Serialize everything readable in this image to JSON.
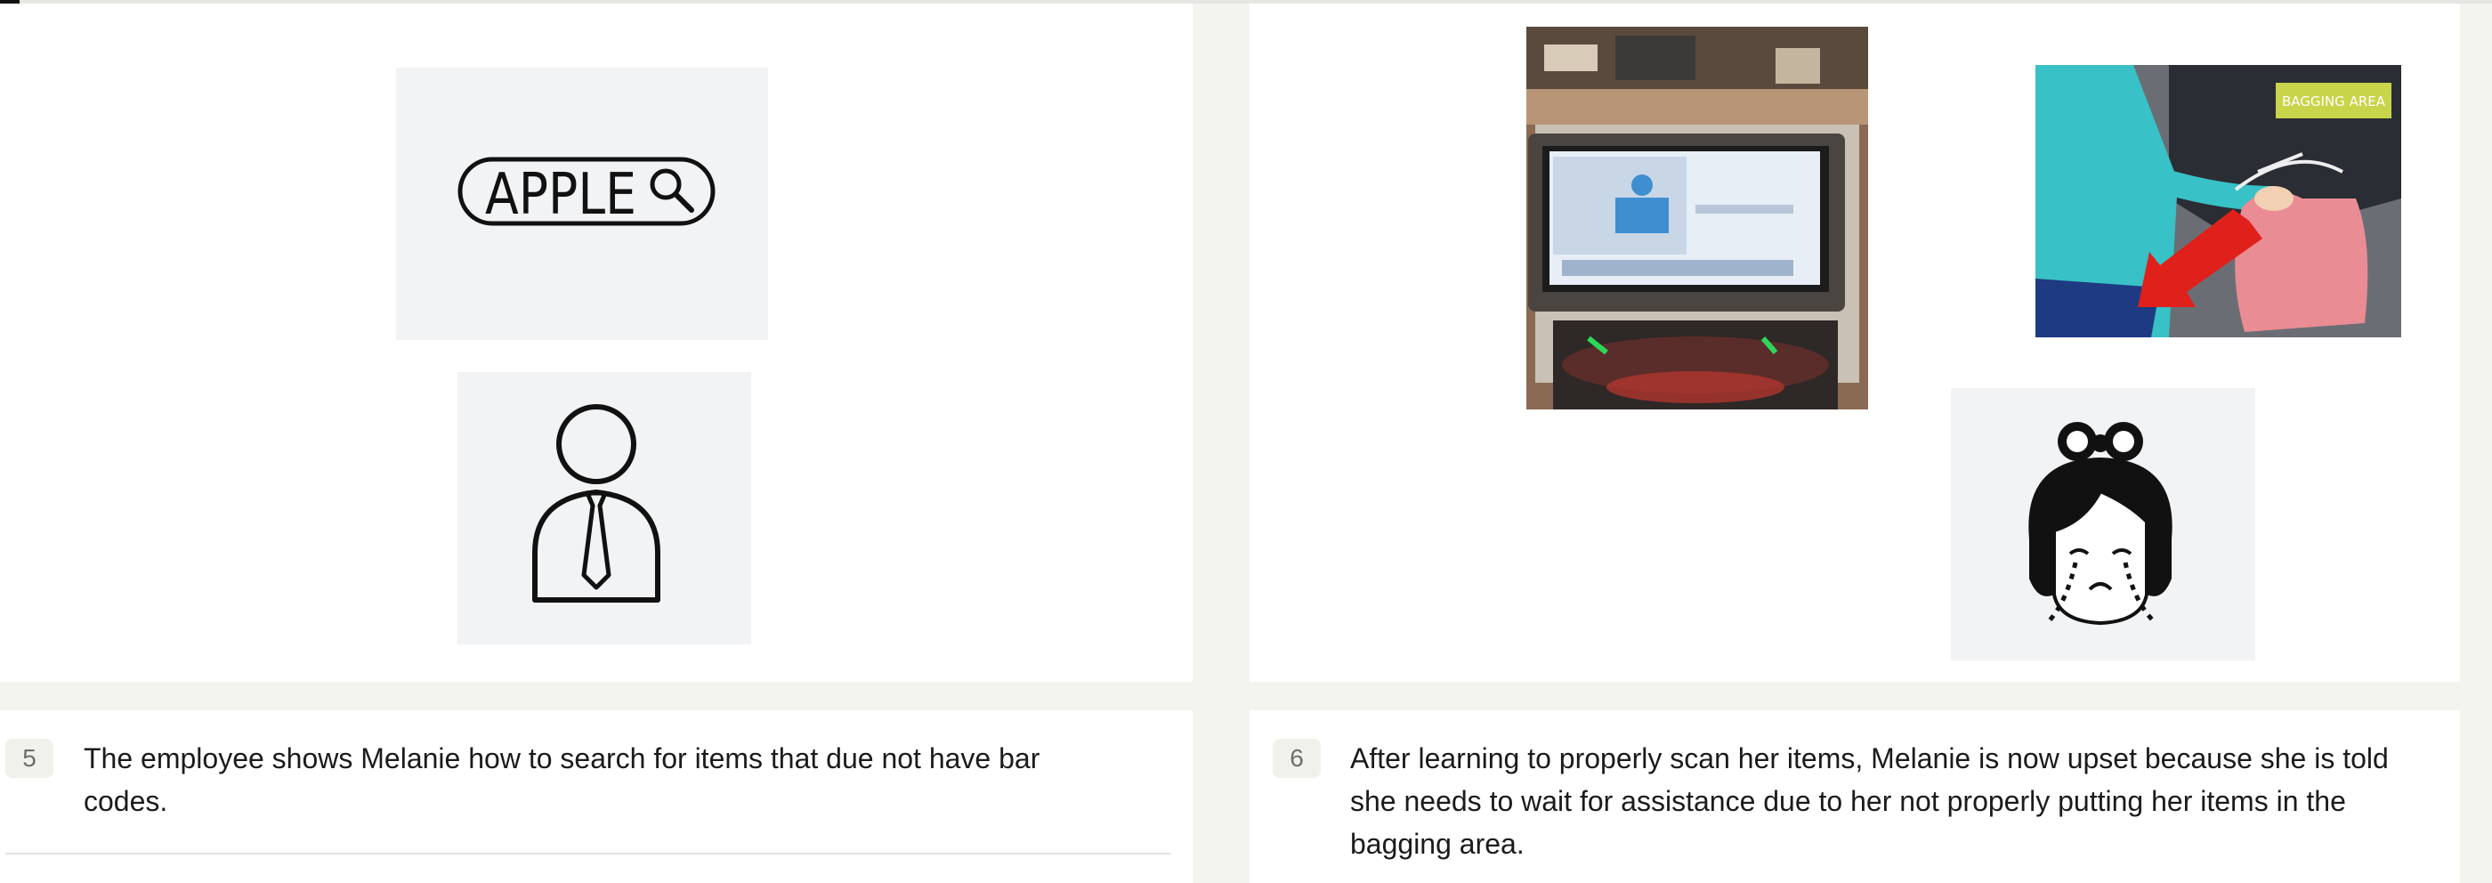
{
  "steps": [
    {
      "number": "5",
      "caption": "The employee shows Melanie how to search for items that due not have bar codes.",
      "images": [
        {
          "name": "search-apple-symbol",
          "text": "APPLE",
          "icon": "search-icon"
        },
        {
          "name": "employee-symbol",
          "icon": "person-with-tie-icon"
        }
      ]
    },
    {
      "number": "6",
      "caption": "After learning to properly scan her items, Melanie is now upset because she is told she needs to wait for assistance due to her not properly putting her items in the bagging area.",
      "images": [
        {
          "name": "self-checkout-screen-photo",
          "icon": "checkout-kiosk-icon"
        },
        {
          "name": "bagging-area-photo",
          "sign_text": "BAGGING AREA",
          "icon": "bagging-arrow-icon"
        },
        {
          "name": "crying-girl-symbol",
          "icon": "crying-face-icon"
        }
      ]
    }
  ],
  "colors": {
    "page_background": "#f4f4ef",
    "card_background": "#ffffff",
    "badge_background": "#f1f1ec",
    "arrow_red": "#e0201a",
    "bag_pink": "#e98c94",
    "shirt_teal": "#3cc3c8",
    "sign_yellow": "#c8d44a"
  }
}
